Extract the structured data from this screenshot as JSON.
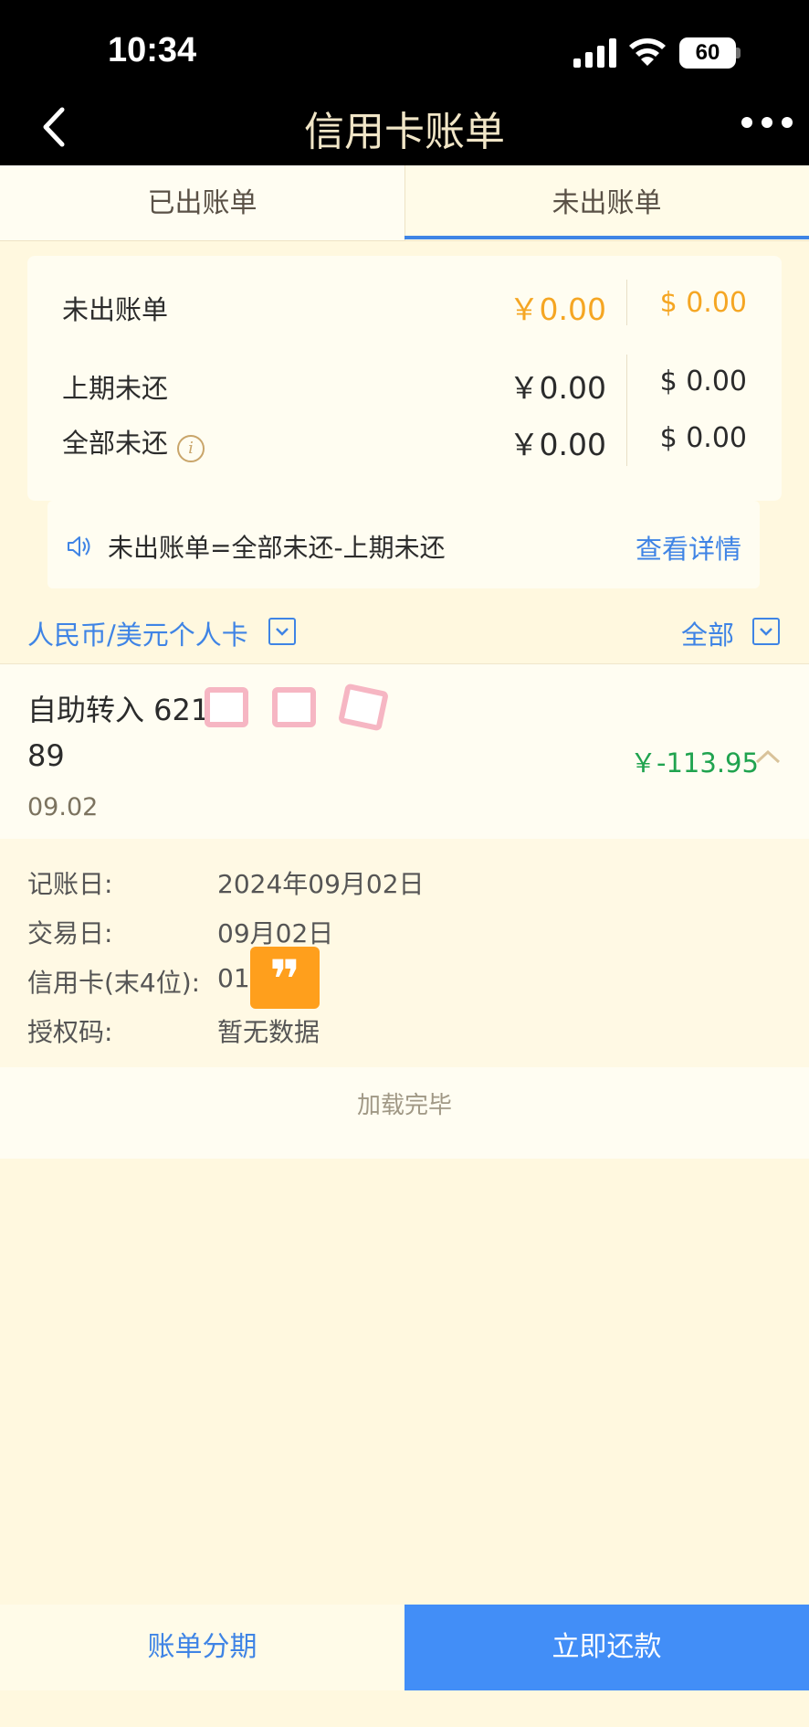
{
  "status_bar": {
    "time": "10:34",
    "battery": "60"
  },
  "nav": {
    "title": "信用卡账单"
  },
  "tabs": [
    {
      "label": "已出账单",
      "active": false
    },
    {
      "label": "未出账单",
      "active": true
    }
  ],
  "summary": {
    "rows": [
      {
        "label": "未出账单",
        "cny": "￥0.00",
        "usd": "$ 0.00",
        "highlight": true
      },
      {
        "label": "上期未还",
        "cny": "￥0.00",
        "usd": "$ 0.00",
        "highlight": false
      },
      {
        "label": "全部未还",
        "cny": "￥0.00",
        "usd": "$ 0.00",
        "highlight": false
      }
    ],
    "formula": "未出账单=全部未还-上期未还",
    "detail_link": "查看详情"
  },
  "filters": {
    "card_type": "人民币/美元个人卡",
    "scope": "全部"
  },
  "transaction": {
    "title_line1": "自助转入 621",
    "title_line2": "89",
    "date": "09.02",
    "amount": "￥-113.95",
    "details": [
      {
        "label": "记账日:",
        "value": "2024年09月02日"
      },
      {
        "label": "交易日:",
        "value": "09月02日"
      },
      {
        "label": "信用卡(末4位):",
        "value": "01"
      },
      {
        "label": "授权码:",
        "value": "暂无数据"
      }
    ]
  },
  "list_footer": "加载完毕",
  "actions": {
    "installment": "账单分期",
    "repay": "立即还款"
  },
  "colors": {
    "accent_blue": "#3f84e5",
    "highlight_orange": "#f5a623",
    "amount_green": "#20a34f",
    "page_bg": "#fff8df"
  }
}
